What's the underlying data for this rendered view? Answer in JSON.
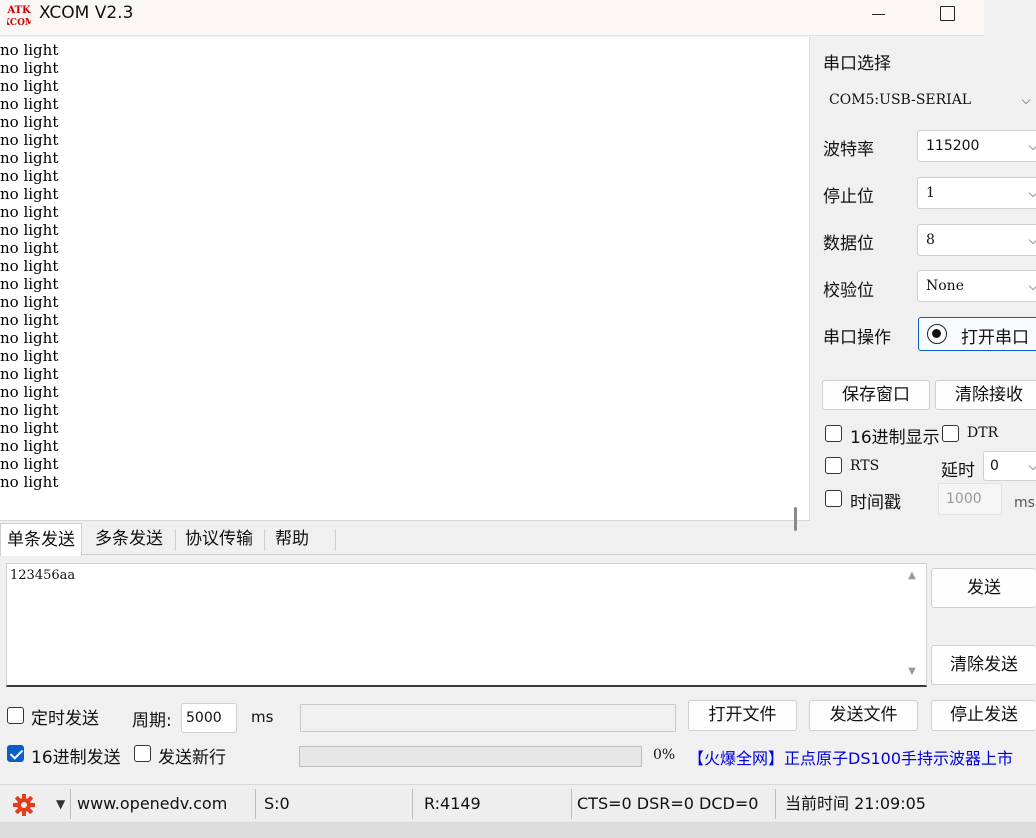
{
  "window": {
    "title": "XCOM V2.3",
    "logo_text_top": "ATK",
    "logo_text_bottom": "XCOM"
  },
  "receive": {
    "lines": [
      "no light",
      "no light",
      "no light",
      "no light",
      "no light",
      "no light",
      "no light",
      "no light",
      "no light",
      "no light",
      "no light",
      "no light",
      "no light",
      "no light",
      "no light",
      "no light",
      "no light",
      "no light",
      "no light",
      "no light",
      "no light",
      "no light",
      "no light",
      "no light",
      "no light"
    ]
  },
  "settings": {
    "port_select_label": "串口选择",
    "port_value": "COM5:USB-SERIAL",
    "baud_label": "波特率",
    "baud_value": "115200",
    "stop_label": "停止位",
    "stop_value": "1",
    "data_label": "数据位",
    "data_value": "8",
    "parity_label": "校验位",
    "parity_value": "None",
    "op_label": "串口操作",
    "open_port_label": "打开串口",
    "save_window_label": "保存窗口",
    "clear_receive_label": "清除接收",
    "hex_display_label": "16进制显示",
    "dtr_label": "DTR",
    "rts_label": "RTS",
    "delay_label": "延时",
    "delay_value": "0",
    "timestamp_label": "时间戳",
    "timestamp_value": "1000",
    "timestamp_unit": "ms",
    "hex_display_checked": false,
    "dtr_checked": false,
    "rts_checked": false,
    "timestamp_checked": false
  },
  "tabs": [
    "单条发送",
    "多条发送",
    "协议传输",
    "帮助"
  ],
  "send": {
    "text": "123456aa",
    "send_label": "发送",
    "clear_send_label": "清除发送",
    "timed_send_label": "定时发送",
    "timed_send_checked": false,
    "period_label": "周期:",
    "period_value": "5000",
    "period_unit": "ms",
    "open_file_label": "打开文件",
    "send_file_label": "发送文件",
    "stop_send_label": "停止发送",
    "hex_send_label": "16进制发送",
    "hex_send_checked": true,
    "newline_label": "发送新行",
    "newline_checked": false,
    "progress_text": "0%",
    "progress": 0,
    "marquee_text": "【火爆全网】正点原子DS100手持示波器上市"
  },
  "status": {
    "website": "www.openedv.com",
    "sent": "S:0",
    "received": "R:4149",
    "lines": "CTS=0 DSR=0 DCD=0",
    "time": "当前时间 21:09:05"
  },
  "colors": {
    "accent": "#0a5fc6",
    "marquee": "#0000e0",
    "gear": "#e23c1c"
  },
  "icons": [
    "gear-icon",
    "chevron-down-icon",
    "minimize-icon",
    "maximize-icon"
  ]
}
